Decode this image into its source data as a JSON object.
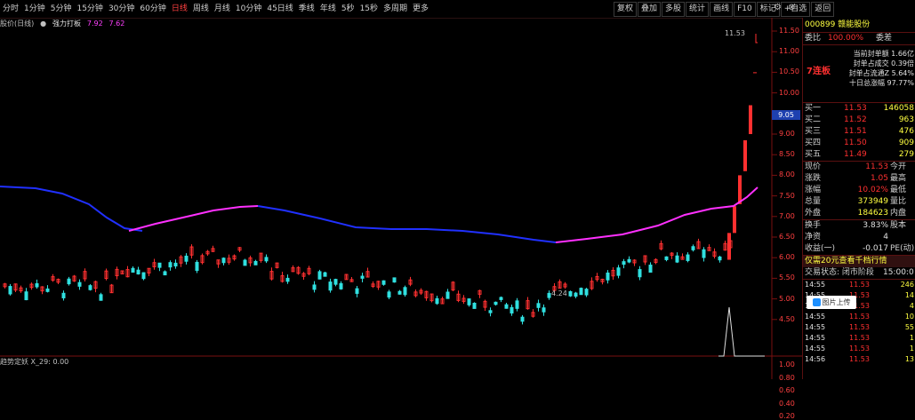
{
  "topbar": {
    "periods": [
      "分时",
      "1分钟",
      "5分钟",
      "15分钟",
      "30分钟",
      "60分钟",
      "日线",
      "周线",
      "月线",
      "10分钟",
      "45日线",
      "季线",
      "年线",
      "5秒",
      "15秒",
      "多周期",
      "更多"
    ],
    "active_period": "日线",
    "tools": [
      "复权",
      "叠加",
      "多股",
      "统计",
      "画线",
      "F10",
      "标记",
      "+自选",
      "返回"
    ]
  },
  "indicator_row": {
    "name": "股价(日线)",
    "indicator": "强力打板",
    "values": [
      "7.92",
      "7.62"
    ]
  },
  "chart": {
    "price_axis": [
      "11.50",
      "11.00",
      "10.50",
      "10.00",
      "9.50",
      "9.00",
      "8.50",
      "8.00",
      "7.50",
      "7.00",
      "6.50",
      "6.00",
      "5.50",
      "5.00",
      "4.50"
    ],
    "current_price_tag": "9.05",
    "last_price_label": "11.53",
    "low_price_label": "4.24",
    "sub_indicator": "趋势定妖  X_29: 0.00",
    "sub_axis": [
      "1.00",
      "0.80",
      "0.60",
      "0.40",
      "0.20"
    ],
    "colors": {
      "up": "#ff3030",
      "down": "#30e0e0",
      "ma_blue": "#2030ff",
      "ma_pink": "#ff30ff"
    }
  },
  "panel": {
    "code": "000899",
    "name": "赣能股份",
    "weibi_label": "委比",
    "weibi_value": "100.00%",
    "weicha_label": "委差",
    "streak": "7连板",
    "seal": [
      "当前封单额 1.66亿",
      "封单占成交 0.39倍",
      "封单占流通Z 5.64%",
      "十日总涨幅 97.77%"
    ],
    "bids": [
      {
        "label": "买一",
        "price": "11.53",
        "vol": "146058"
      },
      {
        "label": "买二",
        "price": "11.52",
        "vol": "963"
      },
      {
        "label": "买三",
        "price": "11.51",
        "vol": "476"
      },
      {
        "label": "买四",
        "price": "11.50",
        "vol": "909"
      },
      {
        "label": "买五",
        "price": "11.49",
        "vol": "279"
      }
    ],
    "quote": [
      {
        "l": "现价",
        "v": "11.53",
        "r": "今开"
      },
      {
        "l": "涨跌",
        "v": "1.05",
        "r": "最高"
      },
      {
        "l": "涨幅",
        "v": "10.02%",
        "r": "最低"
      },
      {
        "l": "总量",
        "v": "373949",
        "r": "量比"
      },
      {
        "l": "外盘",
        "v": "184623",
        "r": "内盘"
      }
    ],
    "stats": [
      {
        "l": "换手",
        "v": "3.83%",
        "r": "股本"
      },
      {
        "l": "净资",
        "v": "4",
        "r": ""
      },
      {
        "l": "收益(一)",
        "v": "-0.017",
        "r": "PE(动)"
      }
    ],
    "ad": "仅需20元查看千档行情",
    "trade_status": "交易状态: 闭市阶段",
    "trade_time": "15:00:0",
    "ticks": [
      {
        "t": "14:55",
        "p": "11.53",
        "v": "246"
      },
      {
        "t": "14:55",
        "p": "11.53",
        "v": "14"
      },
      {
        "t": "14:55",
        "p": "11.53",
        "v": "4"
      },
      {
        "t": "14:55",
        "p": "11.53",
        "v": "10"
      },
      {
        "t": "14:55",
        "p": "11.53",
        "v": "55"
      },
      {
        "t": "14:55",
        "p": "11.53",
        "v": "1"
      },
      {
        "t": "14:55",
        "p": "11.53",
        "v": "1"
      },
      {
        "t": "14:56",
        "p": "11.53",
        "v": "13"
      }
    ],
    "float_button": "图片上传"
  }
}
